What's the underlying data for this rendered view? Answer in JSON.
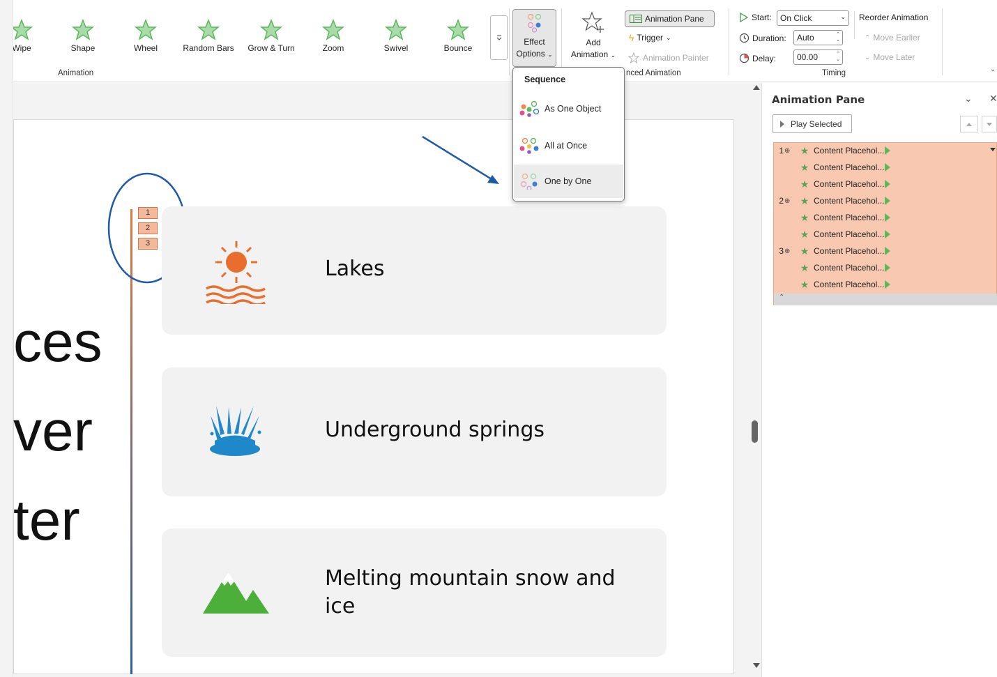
{
  "ribbon": {
    "gallery": [
      {
        "label": "Wipe",
        "icon": "wipe-star-icon"
      },
      {
        "label": "Shape",
        "icon": "shape-star-icon"
      },
      {
        "label": "Wheel",
        "icon": "wheel-star-icon"
      },
      {
        "label": "Random Bars",
        "icon": "random-bars-star-icon"
      },
      {
        "label": "Grow & Turn",
        "icon": "grow-turn-star-icon"
      },
      {
        "label": "Zoom",
        "icon": "zoom-star-icon"
      },
      {
        "label": "Swivel",
        "icon": "swivel-star-icon"
      },
      {
        "label": "Bounce",
        "icon": "bounce-star-icon"
      }
    ],
    "animation_group_label": "Animation",
    "effect_options_line1": "Effect",
    "effect_options_line2": "Options",
    "add_animation_line1": "Add",
    "add_animation_line2": "Animation",
    "animation_pane_label": "Animation Pane",
    "trigger_label": "Trigger",
    "animation_painter_label": "Animation Painter",
    "advanced_group_label": "nced Animation",
    "start_label": "Start:",
    "start_value": "On Click",
    "duration_label": "Duration:",
    "duration_value": "Auto",
    "delay_label": "Delay:",
    "delay_value": "00.00",
    "timing_group_label": "Timing",
    "reorder_label": "Reorder Animation",
    "move_earlier_label": "Move Earlier",
    "move_later_label": "Move Later",
    "accent_green": "#5cb85c"
  },
  "dropdown": {
    "header": "Sequence",
    "items": [
      {
        "label": "As One Object"
      },
      {
        "label": "All at Once"
      },
      {
        "label": "One by One"
      }
    ]
  },
  "slide": {
    "big_words": [
      "ces",
      "ver",
      "ter"
    ],
    "sequence_tags": [
      "1",
      "2",
      "3"
    ],
    "cards": [
      {
        "text": "Lakes",
        "icon": "sun-over-water-icon",
        "color": "#e96d2c"
      },
      {
        "text": "Underground springs",
        "icon": "water-splash-icon",
        "color": "#1e88c8"
      },
      {
        "text": "Melting mountain snow and ice",
        "icon": "mountain-icon",
        "color": "#4caf3a"
      }
    ]
  },
  "pane": {
    "title": "Animation Pane",
    "play_selected": "Play Selected",
    "rows": [
      {
        "num": "1",
        "label": "Content Placehol..."
      },
      {
        "num": "",
        "label": "Content Placehol..."
      },
      {
        "num": "",
        "label": "Content Placehol..."
      },
      {
        "num": "2",
        "label": "Content Placehol..."
      },
      {
        "num": "",
        "label": "Content Placehol..."
      },
      {
        "num": "",
        "label": "Content Placehol..."
      },
      {
        "num": "3",
        "label": "Content Placehol..."
      },
      {
        "num": "",
        "label": "Content Placehol..."
      },
      {
        "num": "",
        "label": "Content Placehol..."
      }
    ],
    "highlight_color": "#f8c9b0"
  }
}
